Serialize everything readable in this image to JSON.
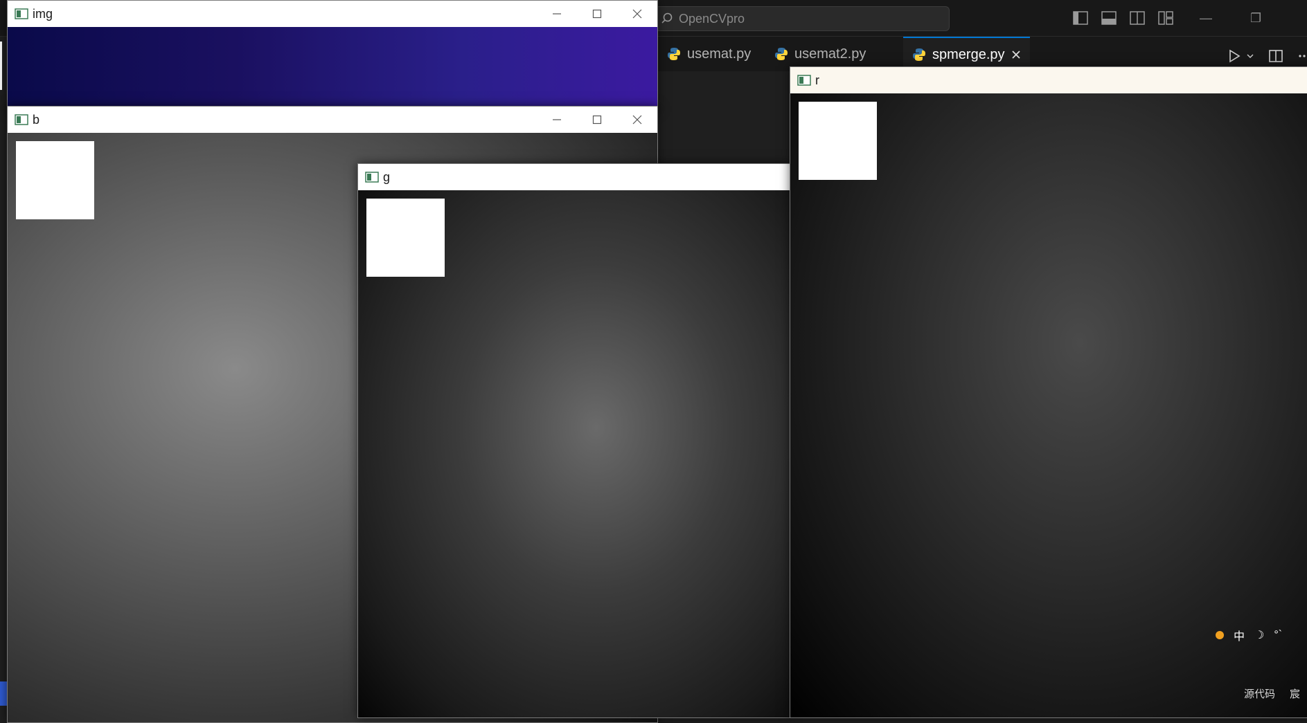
{
  "editor": {
    "search_text": "OpenCVpro",
    "tabs": [
      {
        "label": "usemat.py"
      },
      {
        "label": "usemat2.py"
      },
      {
        "label": "spmerge.py"
      }
    ]
  },
  "windows": {
    "img": {
      "title": "img"
    },
    "b": {
      "title": "b"
    },
    "g": {
      "title": "g"
    },
    "r": {
      "title": "r"
    }
  },
  "tray": {
    "ime": "中",
    "moon": "☽",
    "gear": "°`"
  },
  "watermark": {
    "text": "源代码",
    "extra": "宸"
  },
  "colors": {
    "accent": "#0078d4",
    "python_blue": "#3572a5",
    "python_yellow": "#ffd43b"
  }
}
